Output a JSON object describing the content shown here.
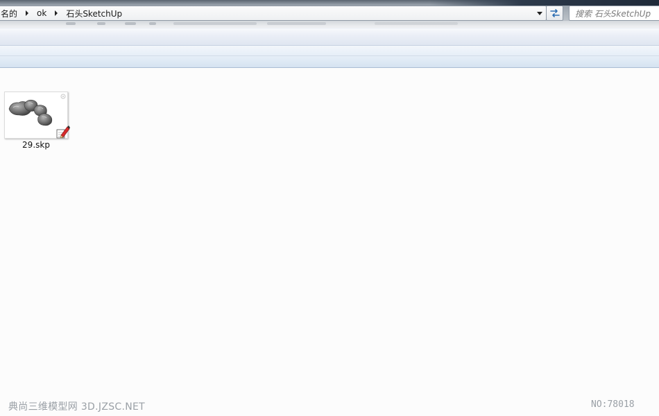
{
  "address_bar": {
    "crumbs": [
      "名的",
      "ok",
      "石头SketchUp"
    ]
  },
  "search": {
    "placeholder": "搜索 石头SketchUp"
  },
  "files": [
    {
      "name": "29.skp",
      "icon": "sketchup-file-icon"
    }
  ],
  "watermark": {
    "left": "典尚三维模型网 3D.JZSC.NET",
    "right": "NO:78018"
  },
  "colors": {
    "toolbar_blue": "#dfe6f1",
    "content_bg": "#fcfcfc",
    "watermark_gray": "#9aa0a6"
  }
}
